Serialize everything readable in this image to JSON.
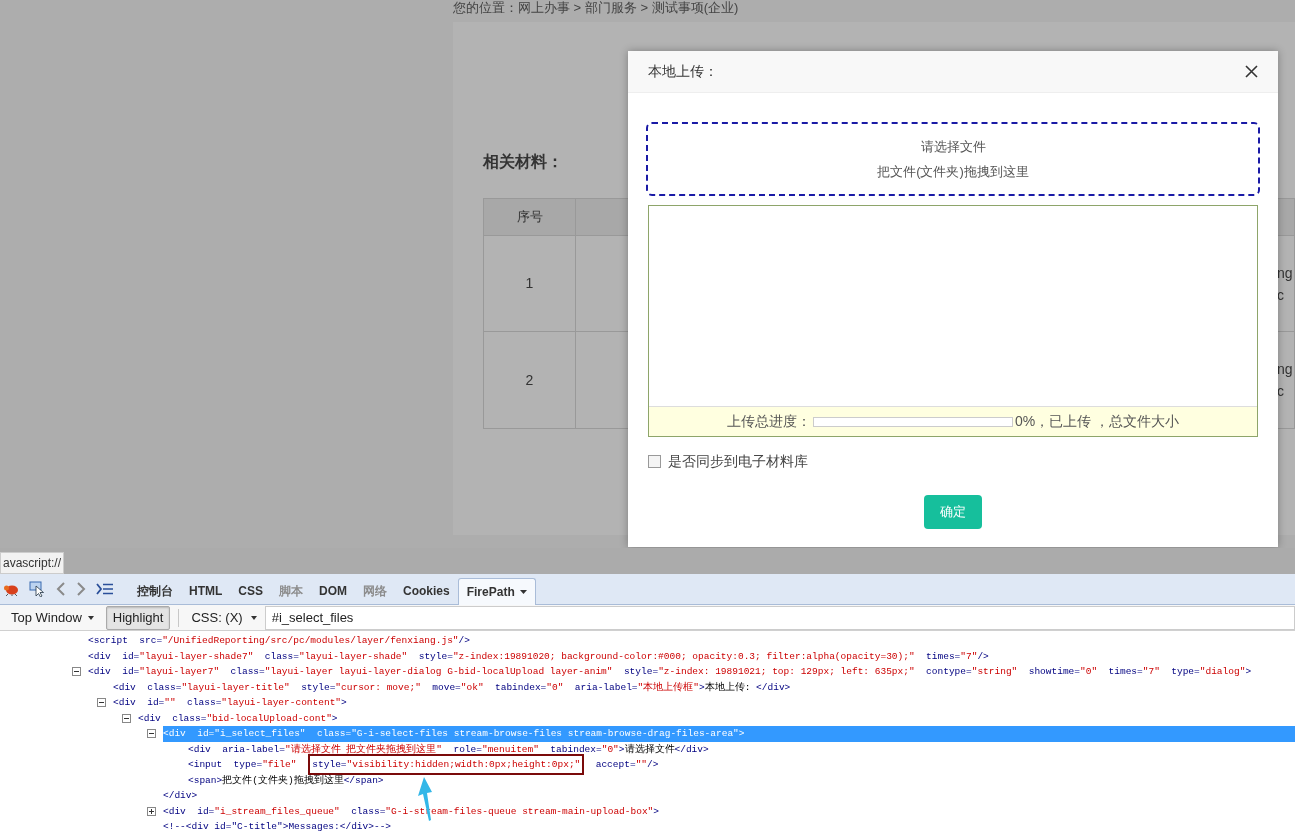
{
  "page": {
    "breadcrumb": "您的位置：网上办事 > 部门服务 > 测试事项(企业)",
    "section_title": "相关材料：",
    "table": {
      "columns": [
        "序号"
      ],
      "rows": [
        {
          "index": "1",
          "column_3": [
            "ng",
            "c"
          ]
        },
        {
          "index": "2",
          "column_3": [
            "ng",
            "c"
          ]
        }
      ]
    }
  },
  "dialog": {
    "title": "本地上传：",
    "drop_area": {
      "title": "请选择文件",
      "hint": "把文件(文件夹)拖拽到这里"
    },
    "progress": {
      "label": "上传总进度：",
      "level": 0,
      "summary": "0%，已上传 ，总文件大小"
    },
    "sync_checkbox": {
      "label": "是否同步到电子材料库",
      "checked": false
    },
    "confirm_button": "确定"
  },
  "status_bar": "avascript://",
  "devtools": {
    "tabs": [
      {
        "label": "控制台",
        "selected": false,
        "disabled": false
      },
      {
        "label": "HTML",
        "selected": false,
        "disabled": false
      },
      {
        "label": "CSS",
        "selected": false,
        "disabled": false
      },
      {
        "label": "脚本",
        "selected": false,
        "disabled": true
      },
      {
        "label": "DOM",
        "selected": false,
        "disabled": false
      },
      {
        "label": "网络",
        "selected": false,
        "disabled": true
      },
      {
        "label": "Cookies",
        "selected": false,
        "disabled": false
      },
      {
        "label": "FirePath",
        "selected": true,
        "disabled": false
      }
    ],
    "window_menu": "Top Window",
    "highlight": {
      "label": "Highlight",
      "pressed": true
    },
    "selector_type": "CSS: (X)",
    "selector": "#i_select_files",
    "nodes": [
      {
        "tokens": [
          {
            "kind": "markup",
            "text": "<script  src="
          },
          {
            "kind": "value",
            "text": "\"/UnifiedReporting/src/pc/modules/layer/fenxiang.js\""
          },
          {
            "kind": "markup",
            "text": "/>"
          }
        ],
        "selected": false
      },
      {
        "tokens": [
          {
            "kind": "markup",
            "text": "<div  id="
          },
          {
            "kind": "value",
            "text": "\"layui-layer-shade7\""
          },
          {
            "kind": "markup",
            "text": "  class="
          },
          {
            "kind": "value",
            "text": "\"layui-layer-shade\""
          },
          {
            "kind": "markup",
            "text": "  style="
          },
          {
            "kind": "value",
            "text": "\"z-index:19891020; background-color:#000; opacity:0.3; filter:alpha(opacity=30);\""
          },
          {
            "kind": "markup",
            "text": "  times="
          },
          {
            "kind": "value",
            "text": "\"7\""
          },
          {
            "kind": "markup",
            "text": "/>"
          }
        ],
        "selected": false
      },
      {
        "expanded": true,
        "selected": false,
        "tokens": [
          {
            "kind": "markup",
            "text": "<div  id="
          },
          {
            "kind": "value",
            "text": "\"layui-layer7\""
          },
          {
            "kind": "markup",
            "text": "  class="
          },
          {
            "kind": "value",
            "text": "\"layui-layer layui-layer-dialog G-bid-localUpload layer-anim\""
          },
          {
            "kind": "markup",
            "text": "  style="
          },
          {
            "kind": "value",
            "text": "\"z-index: 19891021; top: 129px; left: 635px;\""
          },
          {
            "kind": "markup",
            "text": "  contype="
          },
          {
            "kind": "value",
            "text": "\"string\""
          },
          {
            "kind": "markup",
            "text": "  showtime="
          },
          {
            "kind": "value",
            "text": "\"0\""
          },
          {
            "kind": "markup",
            "text": "  times="
          },
          {
            "kind": "value",
            "text": "\"7\""
          },
          {
            "kind": "markup",
            "text": "  type="
          },
          {
            "kind": "value",
            "text": "\"dialog\""
          },
          {
            "kind": "markup",
            "text": ">"
          }
        ],
        "children": [
          {
            "selected": false,
            "tokens": [
              {
                "kind": "markup",
                "text": "<div  class="
              },
              {
                "kind": "value",
                "text": "\"layui-layer-title\""
              },
              {
                "kind": "markup",
                "text": "  style="
              },
              {
                "kind": "value",
                "text": "\"cursor: move;\""
              },
              {
                "kind": "markup",
                "text": "  move="
              },
              {
                "kind": "value",
                "text": "\"ok\""
              },
              {
                "kind": "markup",
                "text": "  tabindex="
              },
              {
                "kind": "value",
                "text": "\"0\""
              },
              {
                "kind": "markup",
                "text": "  aria-label="
              },
              {
                "kind": "value",
                "text": "\"本地上传框\""
              },
              {
                "kind": "markup",
                "text": ">"
              },
              {
                "kind": "content",
                "text": "本地上传: "
              },
              {
                "kind": "markup",
                "text": "</div>"
              }
            ]
          },
          {
            "expanded": true,
            "selected": false,
            "tokens": [
              {
                "kind": "markup",
                "text": "<div  id="
              },
              {
                "kind": "value",
                "text": "\"\""
              },
              {
                "kind": "markup",
                "text": "  class="
              },
              {
                "kind": "value",
                "text": "\"layui-layer-content\""
              },
              {
                "kind": "markup",
                "text": ">"
              }
            ],
            "children": [
              {
                "expanded": true,
                "selected": false,
                "tokens": [
                  {
                    "kind": "markup",
                    "text": "<div  class="
                  },
                  {
                    "kind": "value",
                    "text": "\"bid-localUpload-cont\""
                  },
                  {
                    "kind": "markup",
                    "text": ">"
                  }
                ],
                "children": [
                  {
                    "expanded": true,
                    "selected": true,
                    "tokens": [
                      {
                        "kind": "markup",
                        "text": "<div  id="
                      },
                      {
                        "kind": "value",
                        "text": "\"i_select_files\""
                      },
                      {
                        "kind": "markup",
                        "text": "  class="
                      },
                      {
                        "kind": "value",
                        "text": "\"G-i-select-files stream-browse-files stream-browse-drag-files-area\""
                      },
                      {
                        "kind": "markup",
                        "text": ">"
                      }
                    ],
                    "children": [
                      {
                        "selected": false,
                        "tokens": [
                          {
                            "kind": "markup",
                            "text": "<div  aria-label="
                          },
                          {
                            "kind": "value",
                            "text": "\"请选择文件 把文件夹拖拽到这里\""
                          },
                          {
                            "kind": "markup",
                            "text": "  role="
                          },
                          {
                            "kind": "value",
                            "text": "\"menuitem\""
                          },
                          {
                            "kind": "markup",
                            "text": "  tabindex="
                          },
                          {
                            "kind": "value",
                            "text": "\"0\""
                          },
                          {
                            "kind": "markup",
                            "text": ">"
                          },
                          {
                            "kind": "content",
                            "text": "请选择文件"
                          },
                          {
                            "kind": "markup",
                            "text": "</div>"
                          }
                        ]
                      },
                      {
                        "selected": false,
                        "tokens": [
                          {
                            "kind": "markup",
                            "text": "<input  type="
                          },
                          {
                            "kind": "value",
                            "text": "\"file\""
                          },
                          {
                            "kind": "framed",
                            "parts": [
                              {
                                "kind": "markup",
                                "text": "style="
                              },
                              {
                                "kind": "value",
                                "text": "\"visibility:hidden;width:0px;height:0px;\""
                              }
                            ]
                          },
                          {
                            "kind": "markup",
                            "text": "  accept="
                          },
                          {
                            "kind": "value",
                            "text": "\"\""
                          },
                          {
                            "kind": "markup",
                            "text": "/>"
                          }
                        ]
                      },
                      {
                        "selected": false,
                        "tokens": [
                          {
                            "kind": "markup",
                            "text": "<span>"
                          },
                          {
                            "kind": "content",
                            "text": "把文件(文件夹)拖拽到这里"
                          },
                          {
                            "kind": "markup",
                            "text": "</span>"
                          }
                        ]
                      }
                    ]
                  },
                  {
                    "selected": false,
                    "tokens": [
                      {
                        "kind": "markup",
                        "text": "</div>"
                      }
                    ]
                  },
                  {
                    "expanded": false,
                    "selected": false,
                    "tokens": [
                      {
                        "kind": "markup",
                        "text": "<div  id="
                      },
                      {
                        "kind": "value",
                        "text": "\"i_stream_files_queue\""
                      },
                      {
                        "kind": "markup",
                        "text": "  class="
                      },
                      {
                        "kind": "value",
                        "text": "\"G-i-stream-files-queue stream-main-upload-box\""
                      },
                      {
                        "kind": "markup",
                        "text": ">"
                      }
                    ]
                  },
                  {
                    "selected": false,
                    "tokens": [
                      {
                        "kind": "markup",
                        "text": "<!--<div id=\"C-title\">Messages:</div>-->"
                      }
                    ]
                  }
                ]
              }
            ]
          }
        ]
      }
    ]
  }
}
